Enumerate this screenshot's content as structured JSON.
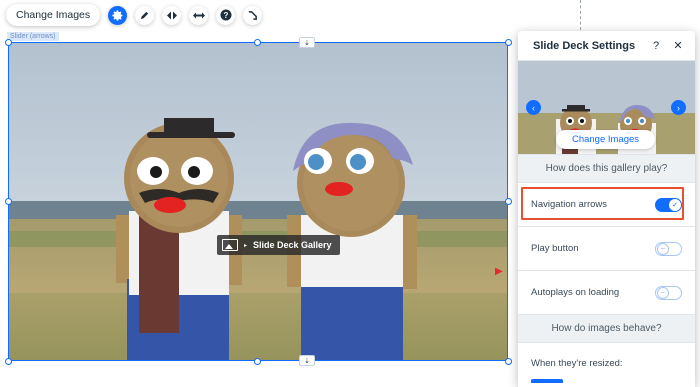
{
  "toolbar": {
    "change_images_label": "Change Images",
    "icons": [
      "gear-icon",
      "pen-icon",
      "animation-icon",
      "stretch-icon",
      "help-icon",
      "link-icon"
    ]
  },
  "selection": {
    "label": "Slider (arrows)",
    "tag_label": "Slide Deck Gallery"
  },
  "panel": {
    "title": "Slide Deck Settings",
    "help_glyph": "?",
    "close_glyph": "✕",
    "preview": {
      "change_images_label": "Change Images",
      "prev_glyph": "‹",
      "next_glyph": "›"
    },
    "section_play": "How does this gallery play?",
    "settings": [
      {
        "label": "Navigation arrows",
        "on": true
      },
      {
        "label": "Play button",
        "on": false
      },
      {
        "label": "Autoplays on loading",
        "on": false
      }
    ],
    "section_images": "How do images behave?",
    "resize_label": "When they're resized:"
  },
  "colors": {
    "accent": "#116dff",
    "highlight": "#e8512f",
    "section_bg": "#eef1f4",
    "arrow_red": "#e4292f"
  }
}
